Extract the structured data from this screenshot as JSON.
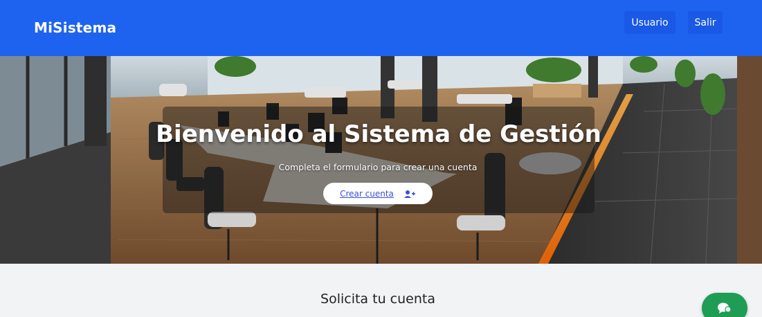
{
  "navbar": {
    "brand": "MiSistema",
    "user_label": "Usuario",
    "logout_label": "Salir"
  },
  "hero": {
    "title": "Bienvenido al Sistema de Gestión",
    "subtitle": "Completa el formulario para crear una cuenta",
    "button_label": "Crear cuenta",
    "button_icon": "user-plus-icon"
  },
  "section": {
    "title": "Solicita tu cuenta"
  },
  "fab": {
    "icon": "chat-icon"
  },
  "colors": {
    "navbar": "#1e63f0",
    "fab": "#1f9d55",
    "button_text": "#3b4fd6"
  }
}
